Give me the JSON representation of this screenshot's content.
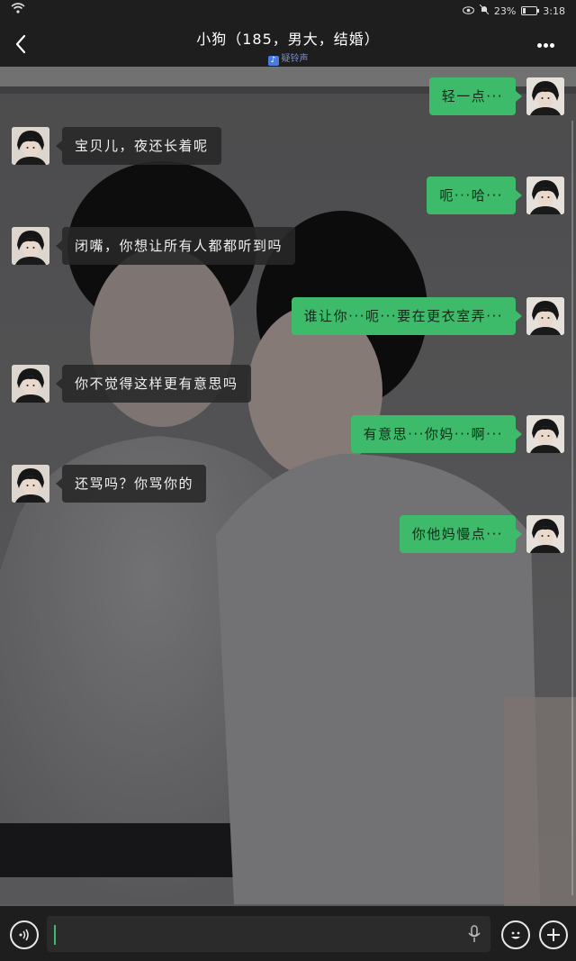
{
  "status_bar": {
    "battery": "23%",
    "time": "3:18"
  },
  "header": {
    "title": "小狗（185，男大，结婚）",
    "subtitle": "疑铃声"
  },
  "messages": [
    {
      "side": "out",
      "text": "轻一点···"
    },
    {
      "side": "in",
      "text": "宝贝儿，夜还长着呢"
    },
    {
      "side": "out",
      "text": "呃···哈···"
    },
    {
      "side": "in",
      "text": "闭嘴，你想让所有人都都听到吗"
    },
    {
      "side": "out",
      "text": "谁让你···呃···要在更衣室弄···"
    },
    {
      "side": "in",
      "text": "你不觉得这样更有意思吗"
    },
    {
      "side": "out",
      "text": "有意思···你妈···啊···"
    },
    {
      "side": "in",
      "text": "还骂吗？你骂你的"
    },
    {
      "side": "out",
      "text": "你他妈慢点···"
    }
  ],
  "colors": {
    "outgoing_bubble": "#3dbb6a",
    "incoming_bubble": "#282828",
    "accent": "#3dbb6a"
  },
  "icons": {
    "back": "chevron-left-icon",
    "more": "more-dots-icon",
    "voice": "voice-icon",
    "mic": "microphone-icon",
    "emoji": "emoji-icon",
    "plus": "plus-icon",
    "wifi": "wifi-icon"
  }
}
